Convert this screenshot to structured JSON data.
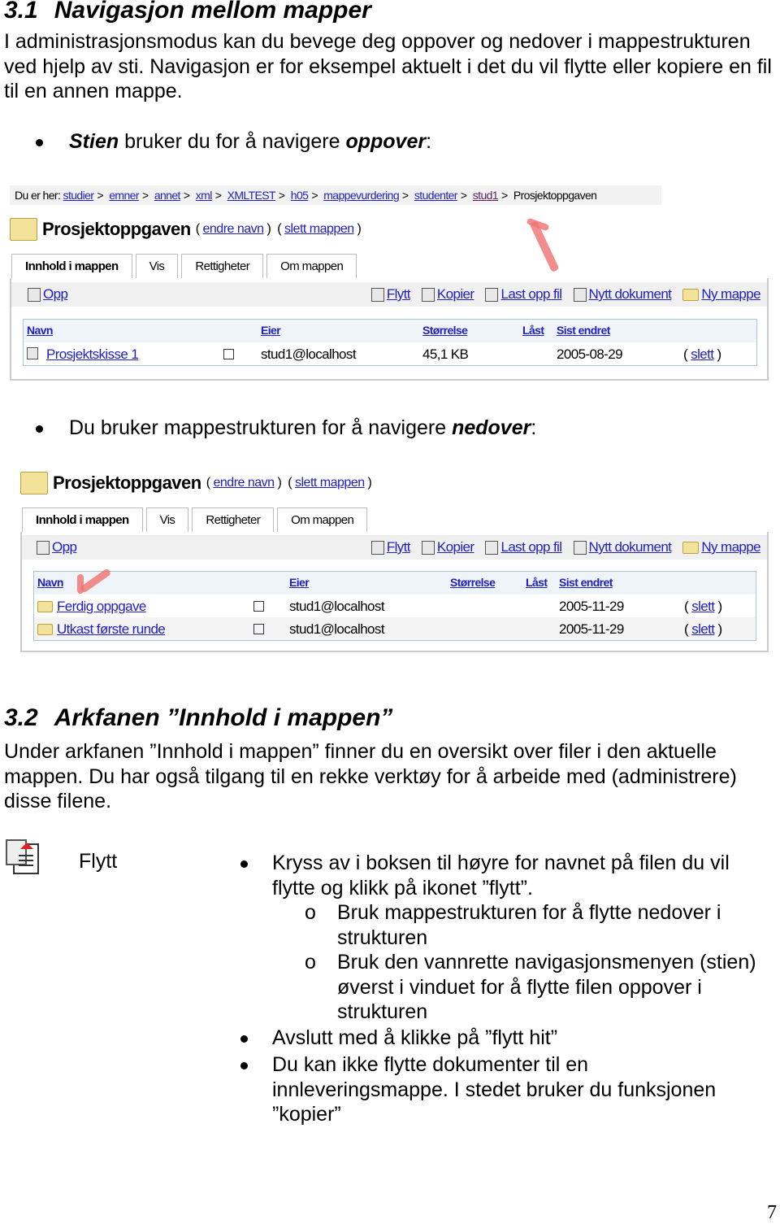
{
  "section31": {
    "number": "3.1",
    "title": "Navigasjon mellom mapper",
    "intro": "I administrasjonsmodus kan du bevege deg oppover og nedover i mappestrukturen ved hjelp av sti. Navigasjon er for eksempel aktuelt i det du vil flytte eller kopiere en fil til en annen mappe.",
    "bullet1": {
      "em": "Stien",
      "mid": " bruker du for å navigere ",
      "strong": "oppover",
      "end": ":"
    },
    "bullet2": {
      "pre": "Du bruker mappestrukturen for å navigere ",
      "strong": "nedover",
      "end": ":"
    }
  },
  "screenshot1": {
    "breadcrumb_label": "Du er her:",
    "breadcrumb": [
      "studier",
      "emner",
      "annet",
      "xml",
      "XMLTEST",
      "h05",
      "mappevurdering",
      "studenter",
      "stud1"
    ],
    "breadcrumb_current": "Prosjektoppgaven",
    "breadcrumb_sep": ">",
    "folder_title": "Prosjektoppgaven",
    "rename": "endre navn",
    "delete_folder": "slett mappen",
    "tabs": [
      "Innhold i mappen",
      "Vis",
      "Rettigheter",
      "Om mappen"
    ],
    "up": "Opp",
    "tools": [
      "Flytt",
      "Kopier",
      "Last opp fil",
      "Nytt dokument",
      "Ny mappe"
    ],
    "columns": [
      "Navn",
      "Eier",
      "Størrelse",
      "Låst",
      "Sist endret"
    ],
    "rows": [
      {
        "name": "Prosjektskisse 1",
        "owner": "stud1@localhost",
        "size": "45,1 KB",
        "date": "2005-08-29",
        "action": "slett"
      }
    ]
  },
  "screenshot2": {
    "folder_title": "Prosjektoppgaven",
    "rename": "endre navn",
    "delete_folder": "slett mappen",
    "tabs": [
      "Innhold i mappen",
      "Vis",
      "Rettigheter",
      "Om mappen"
    ],
    "up": "Opp",
    "tools": [
      "Flytt",
      "Kopier",
      "Last opp fil",
      "Nytt dokument",
      "Ny mappe"
    ],
    "columns": [
      "Navn",
      "Eier",
      "Størrelse",
      "Låst",
      "Sist endret"
    ],
    "rows": [
      {
        "name": "Ferdig oppgave",
        "owner": "stud1@localhost",
        "date": "2005-11-29",
        "action": "slett"
      },
      {
        "name": "Utkast første runde",
        "owner": "stud1@localhost",
        "date": "2005-11-29",
        "action": "slett"
      }
    ]
  },
  "section32": {
    "number": "3.2",
    "title": "Arkfanen ”Innhold i mappen”",
    "intro": "Under arkfanen ”Innhold i mappen” finner du en oversikt over filer i den aktuelle mappen. Du har også tilgang til en rekke verktøy for å arbeide med (administrere) disse filene.",
    "flytt": {
      "icon": "move-document-icon",
      "label": "Flytt",
      "b1": "Kryss av i boksen til høyre for navnet på filen du vil flytte og klikk på ikonet ”flytt”.",
      "s1": "Bruk mappestrukturen for å flytte nedover i strukturen",
      "s2": "Bruk den vannrette navigasjonsmenyen (stien) øverst i vinduet for å flytte filen oppover i strukturen",
      "sub_marker": "o",
      "b2": "Avslutt med å klikke på ”flytt hit”",
      "b3": "Du kan ikke flytte dokumenter til en innleveringsmappe. I stedet bruker du funksjonen ”kopier”"
    }
  },
  "page_number": "7",
  "colors": {
    "link": "#2020c0",
    "arrow": "#f07070",
    "folder": "#f3e39a"
  }
}
